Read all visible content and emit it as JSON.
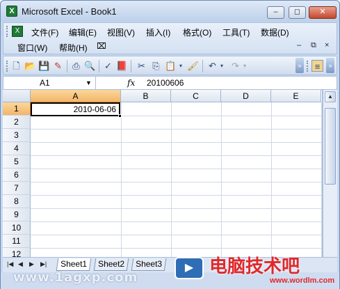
{
  "window": {
    "title": "Microsoft Excel - Book1",
    "app_icon_glyph": "X",
    "minimize": "–",
    "restore": "◻",
    "close": "✕"
  },
  "menu": {
    "doc_icon_glyph": "X",
    "items": [
      "文件(F)",
      "编辑(E)",
      "视图(V)",
      "插入(I)",
      "格式(O)",
      "工具(T)",
      "数据(D)",
      "窗口(W)",
      "帮助(H)"
    ],
    "mdi_minimize": "–",
    "mdi_restore": "⧉",
    "mdi_close": "×"
  },
  "toolbar": {
    "icons": [
      "new-icon",
      "open-icon",
      "save-icon",
      "permission-icon",
      "print-icon",
      "print-preview-icon",
      "spelling-icon",
      "research-icon",
      "cut-icon",
      "copy-icon",
      "paste-icon",
      "format-painter-icon",
      "undo-icon",
      "redo-icon",
      "align-icon"
    ]
  },
  "formula_bar": {
    "name_box": "A1",
    "fx": "fx",
    "value": "20100606"
  },
  "grid": {
    "columns": [
      "A",
      "B",
      "C",
      "D",
      "E"
    ],
    "rows": [
      "1",
      "2",
      "3",
      "4",
      "5",
      "6",
      "7",
      "8",
      "9",
      "10",
      "11",
      "12"
    ],
    "active_cell": "A1",
    "cell_a1": "2010-06-06"
  },
  "sheets": {
    "tabs": [
      "Sheet1",
      "Sheet2",
      "Sheet3"
    ],
    "active": "Sheet1"
  },
  "watermarks": {
    "left": "www.1agxp.com",
    "right_big": "电脑技术吧",
    "right_small": "www.wordlm.com"
  }
}
